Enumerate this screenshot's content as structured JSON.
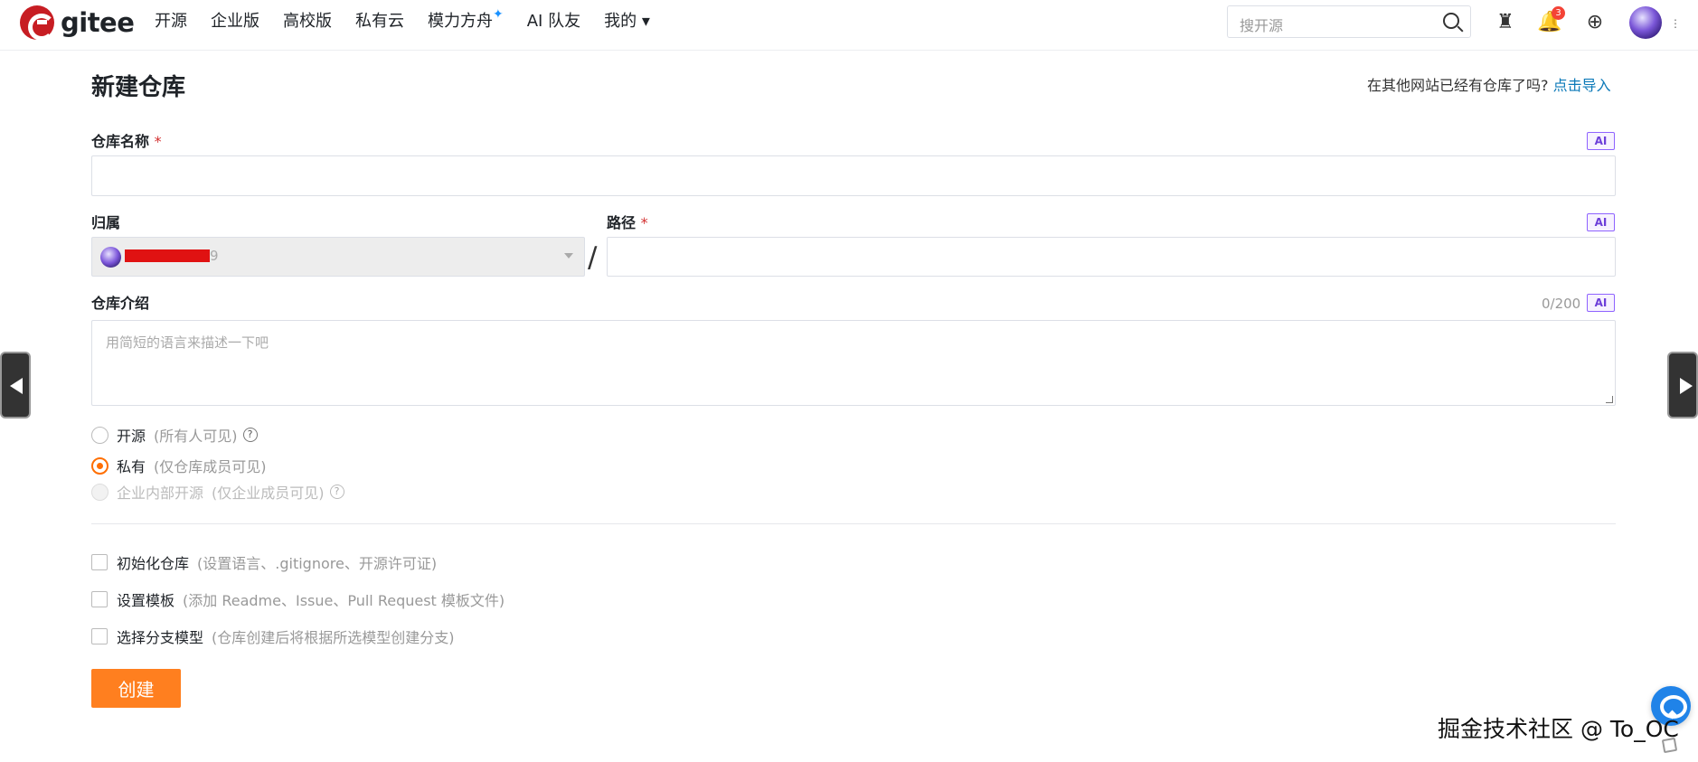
{
  "header": {
    "logo_text": "gitee",
    "nav": [
      "开源",
      "企业版",
      "高校版",
      "私有云",
      "模力方舟",
      "AI 队友",
      "我的"
    ],
    "search_placeholder": "搜开源",
    "notification_count": "3",
    "icons": [
      "copilot-icon",
      "notification-icon",
      "plus-icon",
      "avatar"
    ]
  },
  "page": {
    "title": "新建仓库",
    "import_prompt": "在其他网站已经有仓库了吗?",
    "import_link": "点击导入"
  },
  "form": {
    "repo_name_label": "仓库名称",
    "required_mark": "*",
    "ai_label": "AI",
    "owner_label": "归属",
    "owner_suffix": "9",
    "path_label": "路径",
    "path_separator": "/",
    "description_label": "仓库介绍",
    "description_counter": "0/200",
    "description_placeholder": "用简短的语言来描述一下吧",
    "visibility": [
      {
        "label": "开源",
        "hint": "(所有人可见)",
        "state": "unchecked"
      },
      {
        "label": "私有",
        "hint": "(仅仓库成员可见)",
        "state": "checked"
      },
      {
        "label": "企业内部开源",
        "hint": "(仅企业成员可见)",
        "state": "disabled"
      }
    ],
    "options": [
      {
        "label": "初始化仓库",
        "hint": "(设置语言、.gitignore、开源许可证)"
      },
      {
        "label": "设置模板",
        "hint": "(添加 Readme、Issue、Pull Request 模板文件)"
      },
      {
        "label": "选择分支模型",
        "hint": "(仓库创建后将根据所选模型创建分支)"
      }
    ],
    "create_button": "创建"
  },
  "overlay": {
    "watermark": "掘金技术社区 @ To_OC"
  },
  "colors": {
    "brand_red": "#c71d23",
    "accent_orange": "#ff7f1f",
    "ai_purple": "#8f63ff",
    "link_blue": "#0b79b8"
  }
}
